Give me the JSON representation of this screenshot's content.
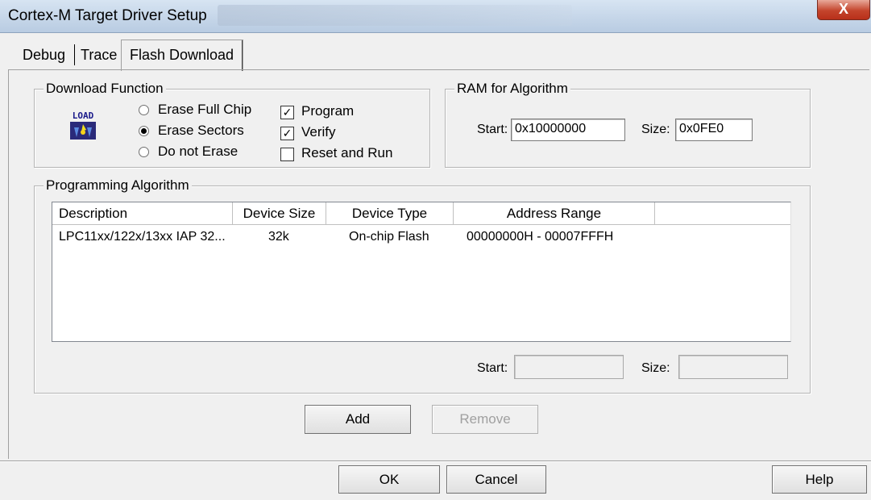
{
  "window": {
    "title": "Cortex-M Target Driver Setup",
    "close_label": "X"
  },
  "tabs": [
    {
      "label": "Debug"
    },
    {
      "label": "Trace"
    },
    {
      "label": "Flash Download"
    }
  ],
  "download_function": {
    "title": "Download Function",
    "load_icon_label": "LOAD",
    "radios": [
      {
        "label": "Erase Full Chip",
        "selected": false
      },
      {
        "label": "Erase Sectors",
        "selected": true
      },
      {
        "label": "Do not Erase",
        "selected": false
      }
    ],
    "checks": [
      {
        "label": "Program",
        "checked": true
      },
      {
        "label": "Verify",
        "checked": true
      },
      {
        "label": "Reset and Run",
        "checked": false
      }
    ]
  },
  "ram_for_algorithm": {
    "title": "RAM for Algorithm",
    "start_label": "Start:",
    "start_value": "0x10000000",
    "size_label": "Size:",
    "size_value": "0x0FE0"
  },
  "programming_algorithm": {
    "title": "Programming Algorithm",
    "columns": [
      "Description",
      "Device Size",
      "Device Type",
      "Address Range"
    ],
    "rows": [
      {
        "description": "LPC11xx/122x/13xx IAP 32...",
        "device_size": "32k",
        "device_type": "On-chip Flash",
        "address_range": "00000000H - 00007FFFH"
      }
    ],
    "start_label": "Start:",
    "start_value": "",
    "size_label": "Size:",
    "size_value": ""
  },
  "buttons": {
    "add": "Add",
    "remove": "Remove",
    "ok": "OK",
    "cancel": "Cancel",
    "help": "Help"
  }
}
